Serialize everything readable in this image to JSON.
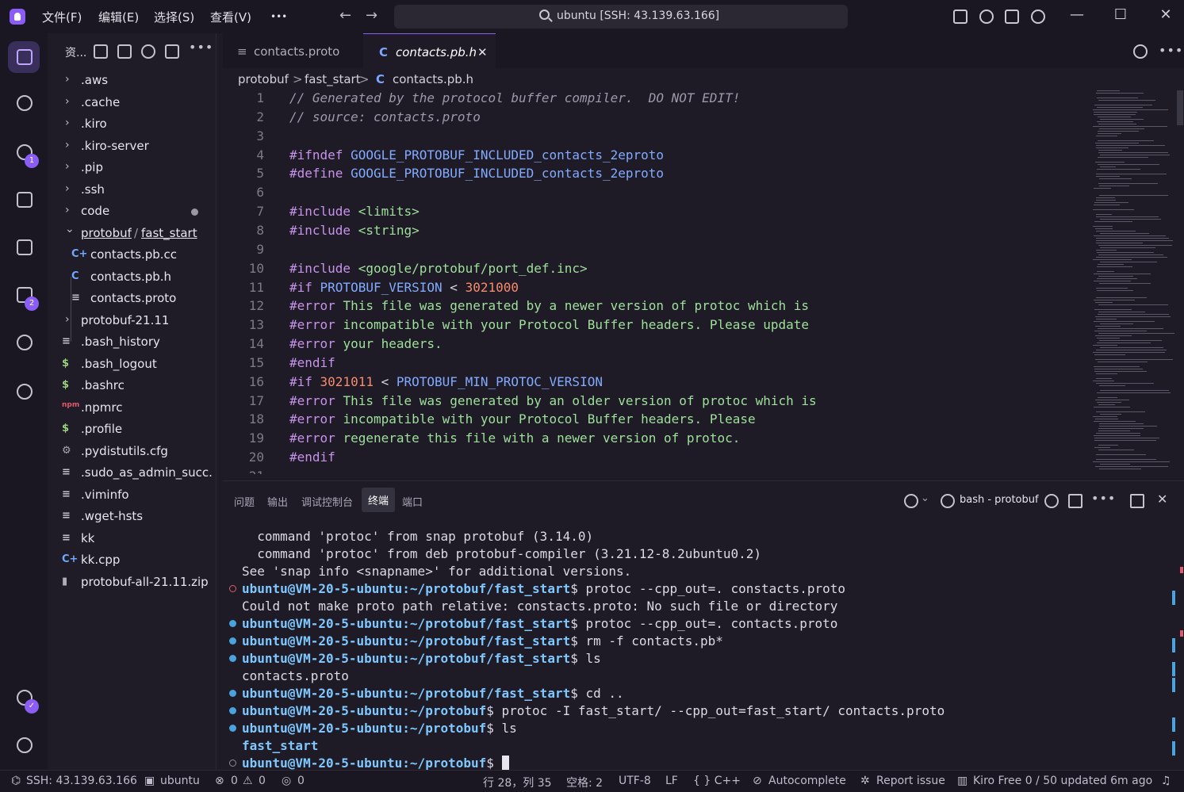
{
  "titlebar": {
    "menus": [
      "文件(F)",
      "编辑(E)",
      "选择(S)",
      "查看(V)",
      "•••"
    ],
    "search_text": "ubuntu [SSH: 43.139.63.166]"
  },
  "activity": {
    "scm_badge": "1",
    "extensions_badge": "2"
  },
  "sidebar": {
    "title": "资...",
    "items": [
      {
        "label": ".aws",
        "type": "folder"
      },
      {
        "label": ".cache",
        "type": "folder"
      },
      {
        "label": ".kiro",
        "type": "folder"
      },
      {
        "label": ".kiro-server",
        "type": "folder"
      },
      {
        "label": ".pip",
        "type": "folder"
      },
      {
        "label": ".ssh",
        "type": "folder"
      },
      {
        "label": "code",
        "type": "folder"
      },
      {
        "label": "protobuf",
        "sep": "/",
        "label2": "fast_start",
        "type": "folder-open"
      },
      {
        "label": "contacts.pb.cc",
        "icon": "C+",
        "type": "file"
      },
      {
        "label": "contacts.pb.h",
        "icon": "C",
        "type": "file"
      },
      {
        "label": "contacts.proto",
        "icon": "≡",
        "type": "file"
      },
      {
        "label": "protobuf-21.11",
        "type": "folder"
      },
      {
        "label": ".bash_history",
        "icon": "≡",
        "type": "file"
      },
      {
        "label": ".bash_logout",
        "icon": "$",
        "type": "file"
      },
      {
        "label": ".bashrc",
        "icon": "$",
        "type": "file"
      },
      {
        "label": ".npmrc",
        "icon": "npm",
        "type": "file"
      },
      {
        "label": ".profile",
        "icon": "$",
        "type": "file"
      },
      {
        "label": ".pydistutils.cfg",
        "icon": "⚙",
        "type": "file"
      },
      {
        "label": ".sudo_as_admin_succ...",
        "icon": "≡",
        "type": "file"
      },
      {
        "label": ".viminfo",
        "icon": "≡",
        "type": "file"
      },
      {
        "label": ".wget-hsts",
        "icon": "≡",
        "type": "file"
      },
      {
        "label": "kk",
        "icon": "≡",
        "type": "file"
      },
      {
        "label": "kk.cpp",
        "icon": "C+",
        "type": "file"
      },
      {
        "label": "protobuf-all-21.11.zip",
        "icon": "▮",
        "type": "file"
      }
    ]
  },
  "editor": {
    "tabs": [
      {
        "label": "contacts.proto",
        "icon": "≡"
      },
      {
        "label": "contacts.pb.h",
        "icon": "C",
        "close": "✕"
      }
    ],
    "breadcrumb": [
      "protobuf",
      ">",
      "fast_start",
      ">",
      "C",
      "contacts.pb.h"
    ],
    "lines": [
      {
        "n": "1",
        "parts": [
          [
            "c-com",
            "// Generated by the protocol buffer compiler.  DO NOT EDIT!"
          ]
        ]
      },
      {
        "n": "2",
        "parts": [
          [
            "c-com",
            "// source: contacts.proto"
          ]
        ]
      },
      {
        "n": "3",
        "parts": []
      },
      {
        "n": "4",
        "parts": [
          [
            "c-pre",
            "#ifndef "
          ],
          [
            "c-mac",
            "GOOGLE_PROTOBUF_INCLUDED_contacts_2eproto"
          ]
        ]
      },
      {
        "n": "5",
        "parts": [
          [
            "c-pre",
            "#define "
          ],
          [
            "c-mac",
            "GOOGLE_PROTOBUF_INCLUDED_contacts_2eproto"
          ]
        ]
      },
      {
        "n": "6",
        "parts": []
      },
      {
        "n": "7",
        "parts": [
          [
            "c-pre",
            "#include "
          ],
          [
            "c-str",
            "<limits>"
          ]
        ]
      },
      {
        "n": "8",
        "parts": [
          [
            "c-pre",
            "#include "
          ],
          [
            "c-str",
            "<string>"
          ]
        ]
      },
      {
        "n": "9",
        "parts": []
      },
      {
        "n": "10",
        "parts": [
          [
            "c-pre",
            "#include "
          ],
          [
            "c-str",
            "<google/protobuf/port_def.inc>"
          ]
        ]
      },
      {
        "n": "11",
        "parts": [
          [
            "c-pre",
            "#if "
          ],
          [
            "c-mac",
            "PROTOBUF_VERSION"
          ],
          [
            "c-txt",
            " < "
          ],
          [
            "c-num",
            "3021000"
          ]
        ]
      },
      {
        "n": "12",
        "parts": [
          [
            "c-pre",
            "#error "
          ],
          [
            "c-str",
            "This file was generated by a newer version of protoc which is"
          ]
        ]
      },
      {
        "n": "13",
        "parts": [
          [
            "c-pre",
            "#error "
          ],
          [
            "c-str",
            "incompatible with your Protocol Buffer headers. Please update"
          ]
        ]
      },
      {
        "n": "14",
        "parts": [
          [
            "c-pre",
            "#error "
          ],
          [
            "c-str",
            "your headers."
          ]
        ]
      },
      {
        "n": "15",
        "parts": [
          [
            "c-pre",
            "#endif"
          ]
        ]
      },
      {
        "n": "16",
        "parts": [
          [
            "c-pre",
            "#if "
          ],
          [
            "c-num",
            "3021011"
          ],
          [
            "c-txt",
            " < "
          ],
          [
            "c-mac",
            "PROTOBUF_MIN_PROTOC_VERSION"
          ]
        ]
      },
      {
        "n": "17",
        "parts": [
          [
            "c-pre",
            "#error "
          ],
          [
            "c-str",
            "This file was generated by an older version of protoc which is"
          ]
        ]
      },
      {
        "n": "18",
        "parts": [
          [
            "c-pre",
            "#error "
          ],
          [
            "c-str",
            "incompatible with your Protocol Buffer headers. Please"
          ]
        ]
      },
      {
        "n": "19",
        "parts": [
          [
            "c-pre",
            "#error "
          ],
          [
            "c-str",
            "regenerate this file with a newer version of protoc."
          ]
        ]
      },
      {
        "n": "20",
        "parts": [
          [
            "c-pre",
            "#endif"
          ]
        ]
      },
      {
        "n": "21",
        "parts": []
      }
    ]
  },
  "panel": {
    "tabs": [
      "问题",
      "输出",
      "调试控制台",
      "终端",
      "端口"
    ],
    "active_tab": "终端",
    "terminal_name": "bash - protobuf",
    "lines": [
      {
        "dot": "",
        "parts": [
          [
            "",
            "  command 'protoc' from snap protobuf (3.14.0)"
          ]
        ]
      },
      {
        "dot": "",
        "parts": [
          [
            "",
            "  command 'protoc' from deb protobuf-compiler (3.21.12-8.2ubuntu0.2)"
          ]
        ]
      },
      {
        "dot": "",
        "parts": [
          [
            "",
            "See 'snap info <snapname>' for additional versions."
          ]
        ]
      },
      {
        "dot": "err",
        "parts": [
          [
            "tprompt",
            "ubuntu@VM-20-5-ubuntu:~/protobuf/fast_start"
          ],
          [
            "",
            "$ protoc --cpp_out=. constacts.proto"
          ]
        ]
      },
      {
        "dot": "",
        "parts": [
          [
            "",
            "Could not make proto path relative: constacts.proto: No such file or directory"
          ]
        ]
      },
      {
        "dot": "blue",
        "parts": [
          [
            "tprompt",
            "ubuntu@VM-20-5-ubuntu:~/protobuf/fast_start"
          ],
          [
            "",
            "$ protoc --cpp_out=. contacts.proto"
          ]
        ]
      },
      {
        "dot": "blue",
        "parts": [
          [
            "tprompt",
            "ubuntu@VM-20-5-ubuntu:~/protobuf/fast_start"
          ],
          [
            "",
            "$ rm -f contacts.pb*"
          ]
        ]
      },
      {
        "dot": "blue",
        "parts": [
          [
            "tprompt",
            "ubuntu@VM-20-5-ubuntu:~/protobuf/fast_start"
          ],
          [
            "",
            "$ ls"
          ]
        ]
      },
      {
        "dot": "",
        "parts": [
          [
            "",
            "contacts.proto"
          ]
        ]
      },
      {
        "dot": "blue",
        "parts": [
          [
            "tprompt",
            "ubuntu@VM-20-5-ubuntu:~/protobuf/fast_start"
          ],
          [
            "",
            "$ cd .."
          ]
        ]
      },
      {
        "dot": "blue",
        "parts": [
          [
            "tprompt",
            "ubuntu@VM-20-5-ubuntu:~/protobuf"
          ],
          [
            "",
            "$ protoc -I fast_start/ --cpp_out=fast_start/ contacts.proto"
          ]
        ]
      },
      {
        "dot": "blue",
        "parts": [
          [
            "tprompt",
            "ubuntu@VM-20-5-ubuntu:~/protobuf"
          ],
          [
            "",
            "$ ls"
          ]
        ]
      },
      {
        "dot": "",
        "parts": [
          [
            "tfolder",
            "fast_start"
          ]
        ]
      },
      {
        "dot": "empty",
        "parts": [
          [
            "tprompt",
            "ubuntu@VM-20-5-ubuntu:~/protobuf"
          ],
          [
            "",
            "$ "
          ]
        ],
        "cursor": true
      }
    ]
  },
  "statusbar": {
    "remote": "SSH: 43.139.63.166",
    "user": "ubuntu",
    "errors": "0",
    "warnings": "0",
    "ports": "0",
    "position": "行 28，列 35",
    "spaces": "空格: 2",
    "encoding": "UTF-8",
    "eol": "LF",
    "language": "{ } C++",
    "autocomplete": "Autocomplete",
    "report": "Report issue",
    "plan": "Kiro Free 0 / 50 updated 6m ago"
  },
  "colors": {
    "accent": "#8b5cf6",
    "prompt": "#7ec8ff",
    "error": "#e05a6a"
  }
}
